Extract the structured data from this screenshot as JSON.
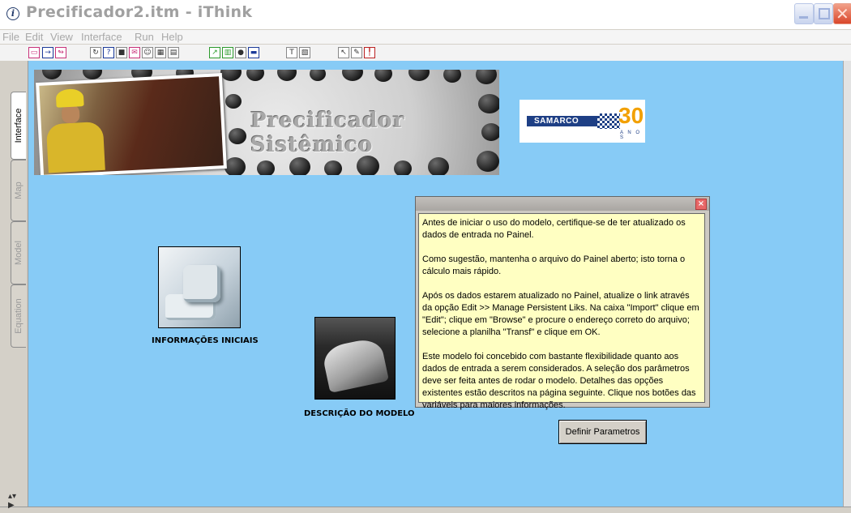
{
  "window": {
    "title": "Precificador2.itm - iThink",
    "app_icon": "info-icon",
    "controls": [
      "minimize",
      "maximize",
      "close"
    ]
  },
  "menu": [
    "File",
    "Edit",
    "View",
    "Interface",
    "Run",
    "Help"
  ],
  "toolbar": {
    "icons": [
      "file-icon",
      "arrow-right-icon",
      "arrow-loop-icon",
      "cycle-icon",
      "help-icon",
      "stop-icon",
      "mail-icon",
      "person-icon",
      "grid-icon",
      "graph-icon",
      "chart-icon",
      "table-icon",
      "radio-icon",
      "toggle-icon",
      "text-tool-icon",
      "picture-tool-icon",
      "pointer-icon",
      "brush-icon",
      "dynamite-icon"
    ]
  },
  "side_tabs": [
    {
      "label": "Interface",
      "active": true
    },
    {
      "label": "Map",
      "active": false
    },
    {
      "label": "Model",
      "active": false
    },
    {
      "label": "Equation",
      "active": false
    }
  ],
  "banner": {
    "title": "Precificador Sistêmico"
  },
  "logo": {
    "text": "SAMARCO",
    "number": "30",
    "sub": "A N O S"
  },
  "buttons": {
    "info_caption": "INFORMAÇÕES INICIAIS",
    "desc_caption": "DESCRIÇÃO DO MODELO",
    "define_label": "Definir Parametros"
  },
  "dialog": {
    "close_glyph": "×",
    "paragraphs": [
      "Antes de iniciar o uso do modelo, certifique-se de ter atualizado os dados de entrada no Painel.",
      "Como sugestão, mantenha o arquivo do Painel aberto; isto torna o cálculo mais rápido.",
      "Após os dados estarem atualizado no Painel, atualize o link através da opção Edit >> Manage Persistent Liks. Na caixa \"Import\" clique em \"Edit\"; clique em \"Browse\" e procure o endereço correto do arquivo; selecione a planilha \"Transf\" e clique em OK.",
      "Este modelo foi concebido com bastante flexibilidade quanto aos dados de entrada a serem considerados. A seleção dos parâmetros deve ser feita antes de rodar o modelo. Detalhes das opções existentes estão descritos na página seguinte. Clique nos botões das variáveis para maiores informações."
    ]
  },
  "colors": {
    "canvas": "#87cbf6",
    "note_bg": "#ffffc2"
  }
}
